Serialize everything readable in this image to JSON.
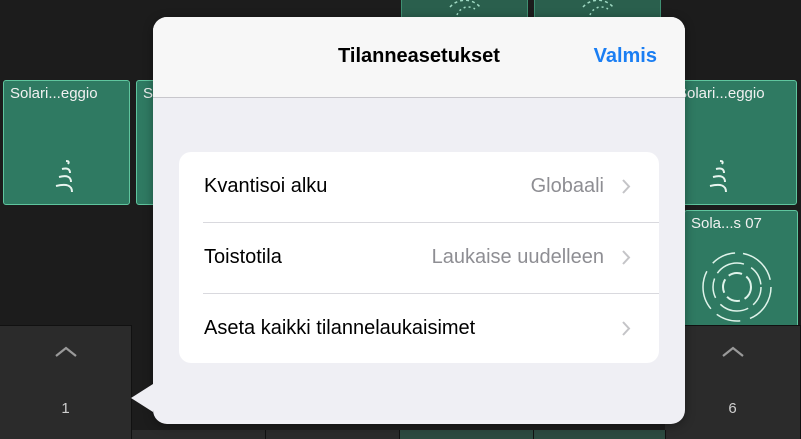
{
  "popover": {
    "title": "Tilanneasetukset",
    "done_label": "Valmis",
    "rows": [
      {
        "label": "Kvantisoi alku",
        "value": "Globaali"
      },
      {
        "label": "Toistotila",
        "value": "Laukaise uudelleen"
      },
      {
        "label": "Aseta kaikki tilannelaukaisimet",
        "value": ""
      }
    ]
  },
  "grid": {
    "cells": [
      {
        "title": "Solari...eggio",
        "icon": "spiral-cone-icon"
      },
      {
        "title": "S",
        "icon": "none"
      },
      {
        "title": "Solari...eggio",
        "icon": "spiral-cone-icon"
      },
      {
        "title": "Sola...s 07",
        "icon": "circular-rings-icon"
      }
    ],
    "triggers": [
      {
        "number": "1"
      },
      {
        "number": "6"
      }
    ]
  },
  "colors": {
    "cell_fill": "#2f7a62",
    "cell_border": "#5fc59e",
    "accent": "#1a7ef3",
    "popover_bg": "#efeff4"
  }
}
